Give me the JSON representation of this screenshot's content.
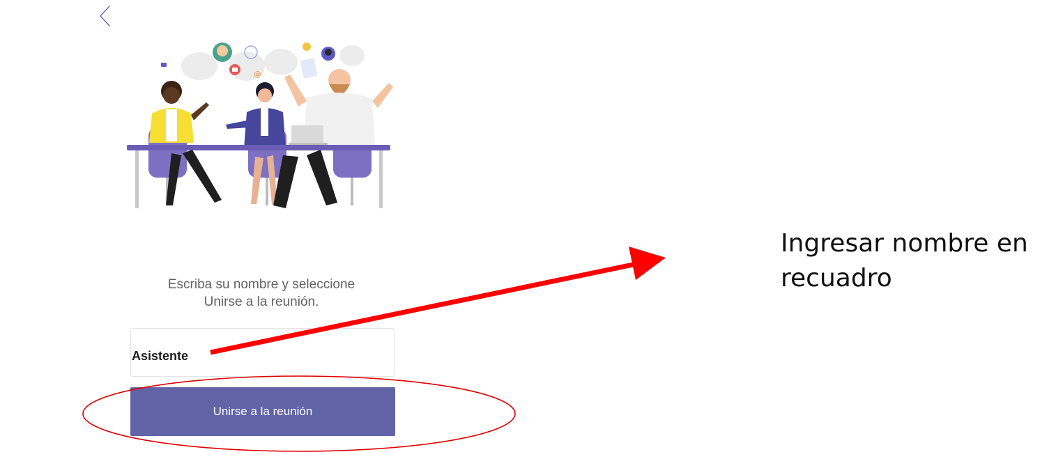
{
  "nav": {
    "back_icon": "chevron-left-icon"
  },
  "illustration": {
    "name": "meeting-people-illustration"
  },
  "prompt": {
    "line1": "Escriba su nombre y seleccione",
    "line2": "Unirse a la reunión."
  },
  "name_input": {
    "value": "Asistente",
    "placeholder": ""
  },
  "join_button": {
    "label": "Unirse a la reunión"
  },
  "annotation": {
    "line1": "Ingresar nombre en",
    "line2": "recuadro",
    "arrow_color": "#ff0000",
    "ellipse_color": "#e00000"
  },
  "colors": {
    "accent": "#6264a7",
    "chair": "#7d6fc2",
    "table": "#6b5db5"
  }
}
